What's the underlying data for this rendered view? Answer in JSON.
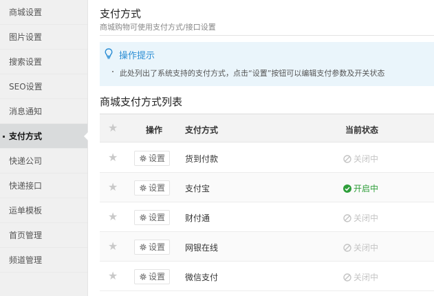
{
  "sidebar": {
    "items": [
      {
        "label": "商城设置"
      },
      {
        "label": "图片设置"
      },
      {
        "label": "搜索设置"
      },
      {
        "label": "SEO设置"
      },
      {
        "label": "消息通知"
      },
      {
        "label": "支付方式"
      },
      {
        "label": "快递公司"
      },
      {
        "label": "快递接口"
      },
      {
        "label": "运单模板"
      },
      {
        "label": "首页管理"
      },
      {
        "label": "频道管理"
      }
    ],
    "active_index": 5
  },
  "header": {
    "title": "支付方式",
    "subtitle": "商城购物可使用支付方式/接口设置"
  },
  "tip": {
    "title": "操作提示",
    "text": "此处列出了系统支持的支付方式，点击“设置”按钮可以编辑支付参数及开关状态"
  },
  "list": {
    "title": "商城支付方式列表",
    "columns": {
      "op": "操作",
      "method": "支付方式",
      "status": "当前状态"
    },
    "set_label": "设置",
    "rows": [
      {
        "name": "货到付款",
        "status": "关闭中",
        "enabled": false
      },
      {
        "name": "支付宝",
        "status": "开启中",
        "enabled": true
      },
      {
        "name": "财付通",
        "status": "关闭中",
        "enabled": false
      },
      {
        "name": "网银在线",
        "status": "关闭中",
        "enabled": false
      },
      {
        "name": "微信支付",
        "status": "关闭中",
        "enabled": false
      }
    ]
  },
  "colors": {
    "accent": "#2a8dd4",
    "on": "#2e9e3a",
    "off": "#c4c4c4",
    "tip_bg": "#eaf5fb"
  }
}
